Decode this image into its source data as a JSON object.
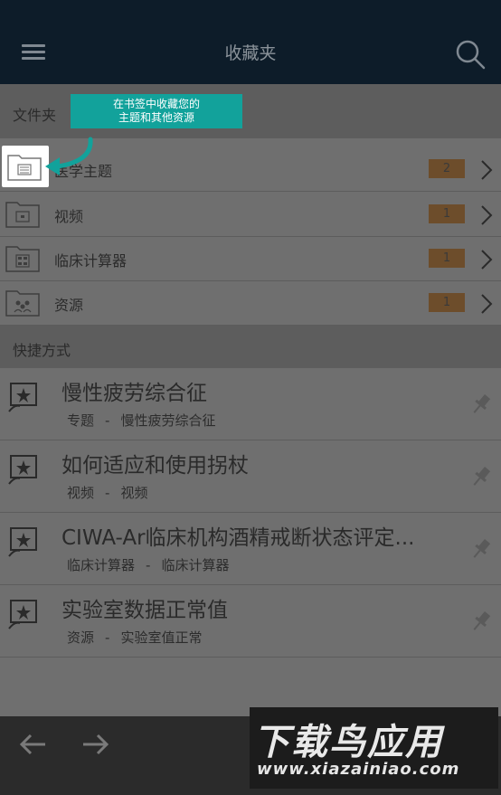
{
  "header": {
    "title": "收藏夹"
  },
  "folders_section": {
    "label": "文件夹"
  },
  "folders": [
    {
      "label": "医学主题",
      "count": "2"
    },
    {
      "label": "视频",
      "count": "1"
    },
    {
      "label": "临床计算器",
      "count": "1"
    },
    {
      "label": "资源",
      "count": "1"
    }
  ],
  "shortcuts_section": {
    "label": "快捷方式"
  },
  "shortcuts": [
    {
      "title": "慢性疲劳综合征",
      "type": "专题",
      "sep": "-",
      "subtitle": "慢性疲劳综合征"
    },
    {
      "title": "如何适应和使用拐杖",
      "type": "视频",
      "sep": "-",
      "subtitle": "视频"
    },
    {
      "title": "CIWA-Ar临床机构酒精戒断状态评定...",
      "type": "临床计算器",
      "sep": "-",
      "subtitle": "临床计算器"
    },
    {
      "title": "实验室数据正常值",
      "type": "资源",
      "sep": "-",
      "subtitle": "实验室值正常"
    }
  ],
  "tooltip": {
    "line1": "在书签中收藏您的",
    "line2": "主题和其他资源"
  },
  "watermark": {
    "big": "下载鸟应用",
    "small": "www.xiazainiao.com"
  },
  "colors": {
    "topbar": "#0d1c29",
    "overlay": "#6f6f6f",
    "tooltip": "#12a29b",
    "badge": "#6d4d2b"
  }
}
